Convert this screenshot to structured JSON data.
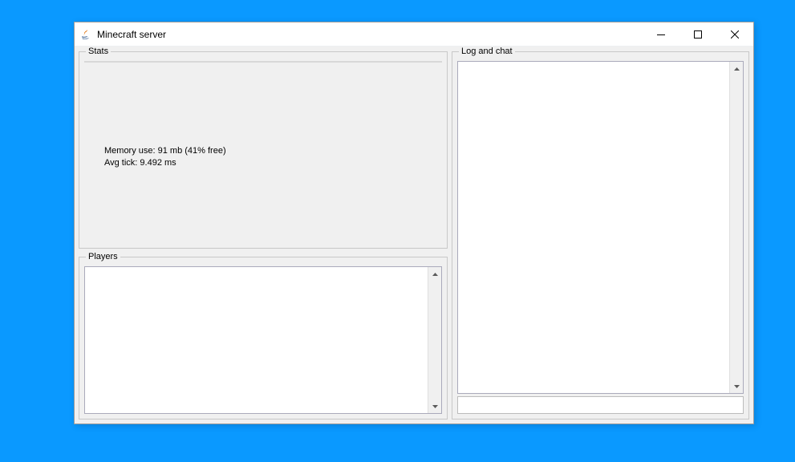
{
  "window": {
    "title": "Minecraft server"
  },
  "labels": {
    "stats_legend": "Stats",
    "players_legend": "Players",
    "log_legend": "Log and chat"
  },
  "stats": {
    "memory_line": "Memory use: 91 mb (41% free)",
    "tick_line": "Avg tick: 9.492 ms"
  },
  "command": {
    "value": ""
  }
}
